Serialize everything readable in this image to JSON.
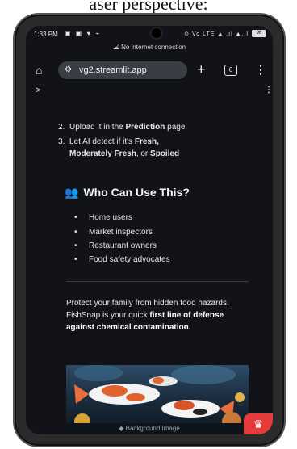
{
  "page_caption": "aser perspective:",
  "statusbar": {
    "time": "1:33 PM",
    "left_icons": "▣ ▣ ♥ ⌁",
    "right_icons": "⊙ Vo LTE ▲ .ıl ▲.ıl",
    "battery": "96"
  },
  "notice": {
    "icon": "no-cloud-icon",
    "text": "No internet connection"
  },
  "browser": {
    "url": "vg2.streamlit.app",
    "tab_count": "6",
    "icons": {
      "home": "home-icon",
      "site_settings": "tune-icon",
      "new_tab": "plus-icon",
      "tabs": "tabs-icon",
      "menu": "kebab-icon"
    }
  },
  "app": {
    "sidebar_toggle": ">",
    "menu": "⋮"
  },
  "steps": [
    {
      "num": "2.",
      "pre": "Upload it in the ",
      "bold": "Prediction",
      "post": " page"
    },
    {
      "num": "3.",
      "pre": "Let AI detect if it's ",
      "bold1": "Fresh,",
      "bold2": "Moderately Fresh",
      "mid": ", or ",
      "bold3": "Spoiled"
    }
  ],
  "who": {
    "icon": "people-icon",
    "title": "Who Can Use This?",
    "items": [
      "Home users",
      "Market inspectors",
      "Restaurant owners",
      "Food safety advocates"
    ]
  },
  "para": {
    "line1": "Protect your family from hidden food hazards.",
    "line2_pre": "FishSnap is your quick ",
    "line2_bold": "first line of defense against chemical contamination.",
    "line2_post": ""
  },
  "image_caption": "Background Image",
  "colors": {
    "bg": "#121318",
    "accent_blue": "#3b82f6",
    "crown_red": "#e63b3b"
  }
}
